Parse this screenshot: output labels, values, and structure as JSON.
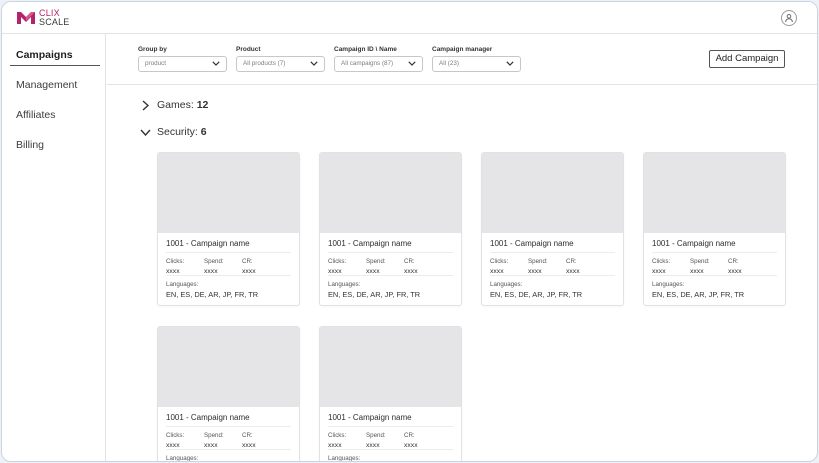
{
  "brand": {
    "line1": "CLIX",
    "line2": "SCALE",
    "accent": "#b3246a"
  },
  "user": {
    "icon": "user-icon"
  },
  "sidebar": {
    "items": [
      {
        "label": "Campaigns",
        "active": true
      },
      {
        "label": "Management",
        "active": false
      },
      {
        "label": "Affiliates",
        "active": false
      },
      {
        "label": "Billing",
        "active": false
      }
    ]
  },
  "filters": [
    {
      "label": "Group by",
      "value": "product"
    },
    {
      "label": "Product",
      "value": "All products (7)"
    },
    {
      "label": "Campaign ID \\ Name",
      "value": "All campaigns (87)"
    },
    {
      "label": "Campaign manager",
      "value": "All (23)"
    }
  ],
  "toolbar": {
    "add_label": "Add Campaign"
  },
  "groups": [
    {
      "name": "Games:",
      "count": "12",
      "expanded": false
    },
    {
      "name": "Security:",
      "count": "6",
      "expanded": true
    }
  ],
  "card_template": {
    "title": "1001 - Campaign name",
    "clicks_label": "Clicks:",
    "clicks_value": "xxxx",
    "spend_label": "Spend:",
    "spend_value": "xxxx",
    "cr_label": "CR:",
    "cr_value": "xxxx",
    "languages_label": "Languages:",
    "languages_value": "EN, ES, DE, AR, JP, FR, TR"
  },
  "cards": [
    {
      "title": "1001 - Campaign name",
      "clicks": "xxxx",
      "spend": "xxxx",
      "cr": "xxxx",
      "languages": "EN, ES, DE, AR, JP, FR, TR"
    },
    {
      "title": "1001 - Campaign name",
      "clicks": "xxxx",
      "spend": "xxxx",
      "cr": "xxxx",
      "languages": "EN, ES, DE, AR, JP, FR, TR"
    },
    {
      "title": "1001 - Campaign name",
      "clicks": "xxxx",
      "spend": "xxxx",
      "cr": "xxxx",
      "languages": "EN, ES, DE, AR, JP, FR, TR"
    },
    {
      "title": "1001 - Campaign name",
      "clicks": "xxxx",
      "spend": "xxxx",
      "cr": "xxxx",
      "languages": "EN, ES, DE, AR, JP, FR, TR"
    },
    {
      "title": "1001 - Campaign name",
      "clicks": "xxxx",
      "spend": "xxxx",
      "cr": "xxxx",
      "languages": ""
    },
    {
      "title": "1001 - Campaign name",
      "clicks": "xxxx",
      "spend": "xxxx",
      "cr": "xxxx",
      "languages": ""
    }
  ]
}
